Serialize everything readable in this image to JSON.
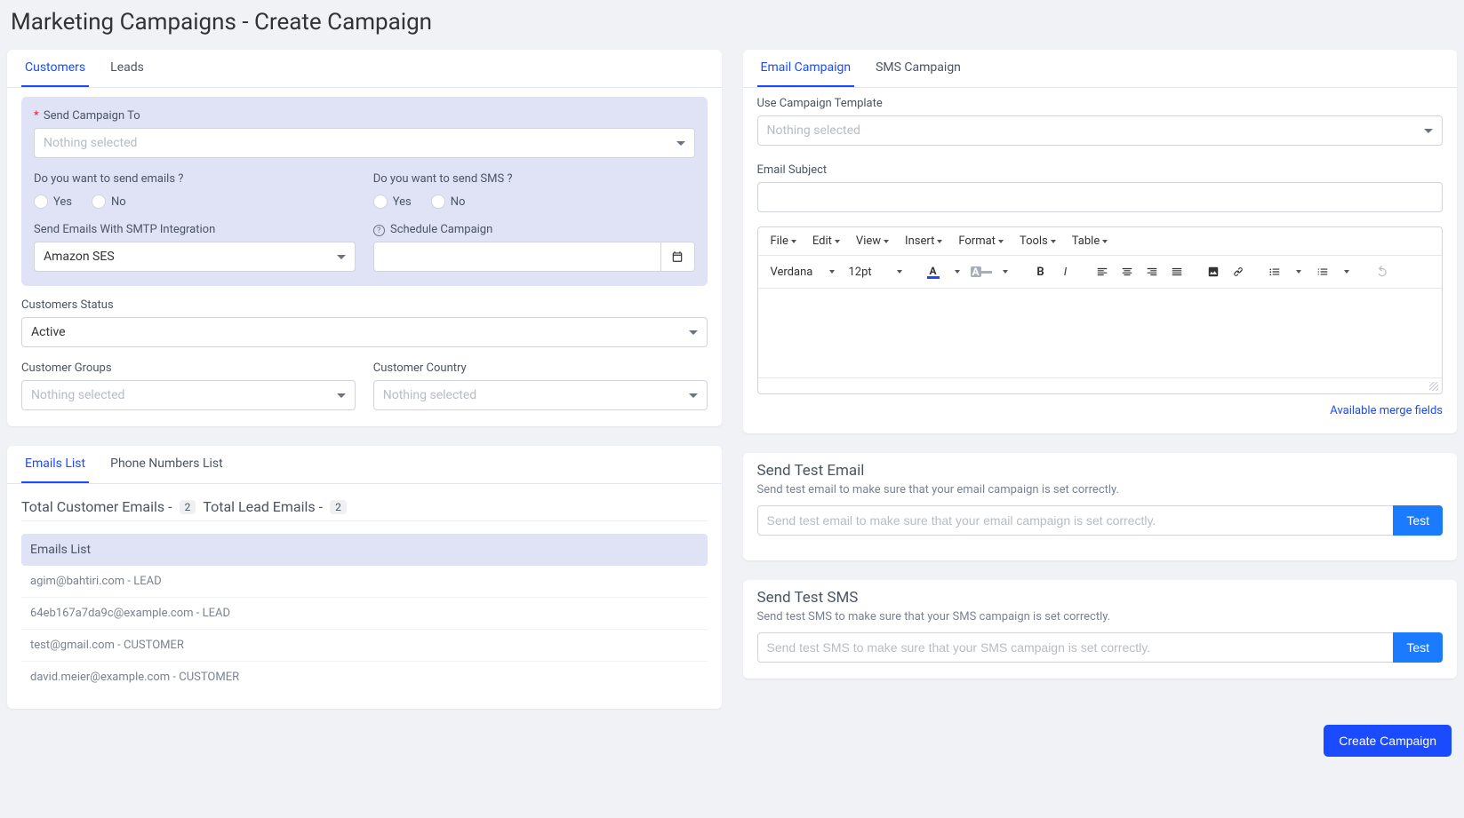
{
  "page_title": "Marketing Campaigns - Create Campaign",
  "left_top_tabs": {
    "customers": "Customers",
    "leads": "Leads"
  },
  "form": {
    "send_to_label": "Send Campaign To",
    "send_to_placeholder": "Nothing selected",
    "send_emails_label": "Do you want to send emails ?",
    "send_sms_label": "Do you want to send SMS ?",
    "yes": "Yes",
    "no": "No",
    "smtp_label": "Send Emails With SMTP Integration",
    "smtp_value": "Amazon SES",
    "schedule_label": "Schedule Campaign",
    "customers_status_label": "Customers Status",
    "customers_status_value": "Active",
    "customer_groups_label": "Customer Groups",
    "customer_groups_placeholder": "Nothing selected",
    "customer_country_label": "Customer Country",
    "customer_country_placeholder": "Nothing selected"
  },
  "list_tabs": {
    "emails": "Emails List",
    "phones": "Phone Numbers List"
  },
  "totals": {
    "customer_label": "Total Customer Emails -",
    "customer_count": "2",
    "lead_label": "Total Lead Emails -",
    "lead_count": "2"
  },
  "emails_list_header": "Emails List",
  "emails_list": [
    {
      "email": "agim@bahtiri.com",
      "tag": "LEAD"
    },
    {
      "email": "64eb167a7da9c@example.com",
      "tag": "LEAD"
    },
    {
      "email": "test@gmail.com",
      "tag": "CUSTOMER"
    },
    {
      "email": "david.meier@example.com",
      "tag": "CUSTOMER"
    }
  ],
  "right_tabs": {
    "email": "Email Campaign",
    "sms": "SMS Campaign"
  },
  "template_label": "Use Campaign Template",
  "template_placeholder": "Nothing selected",
  "subject_label": "Email Subject",
  "editor": {
    "menu": {
      "file": "File",
      "edit": "Edit",
      "view": "View",
      "insert": "Insert",
      "format": "Format",
      "tools": "Tools",
      "table": "Table"
    },
    "font": "Verdana",
    "size": "12pt"
  },
  "merge_link": "Available merge fields",
  "test_email": {
    "title": "Send Test Email",
    "desc": "Send test email to make sure that your email campaign is set correctly.",
    "placeholder": "Send test email to make sure that your email campaign is set correctly.",
    "btn": "Test"
  },
  "test_sms": {
    "title": "Send Test SMS",
    "desc": "Send test SMS to make sure that your SMS campaign is set correctly.",
    "placeholder": "Send test SMS to make sure that your SMS campaign is set correctly.",
    "btn": "Test"
  },
  "create_btn": "Create Campaign"
}
